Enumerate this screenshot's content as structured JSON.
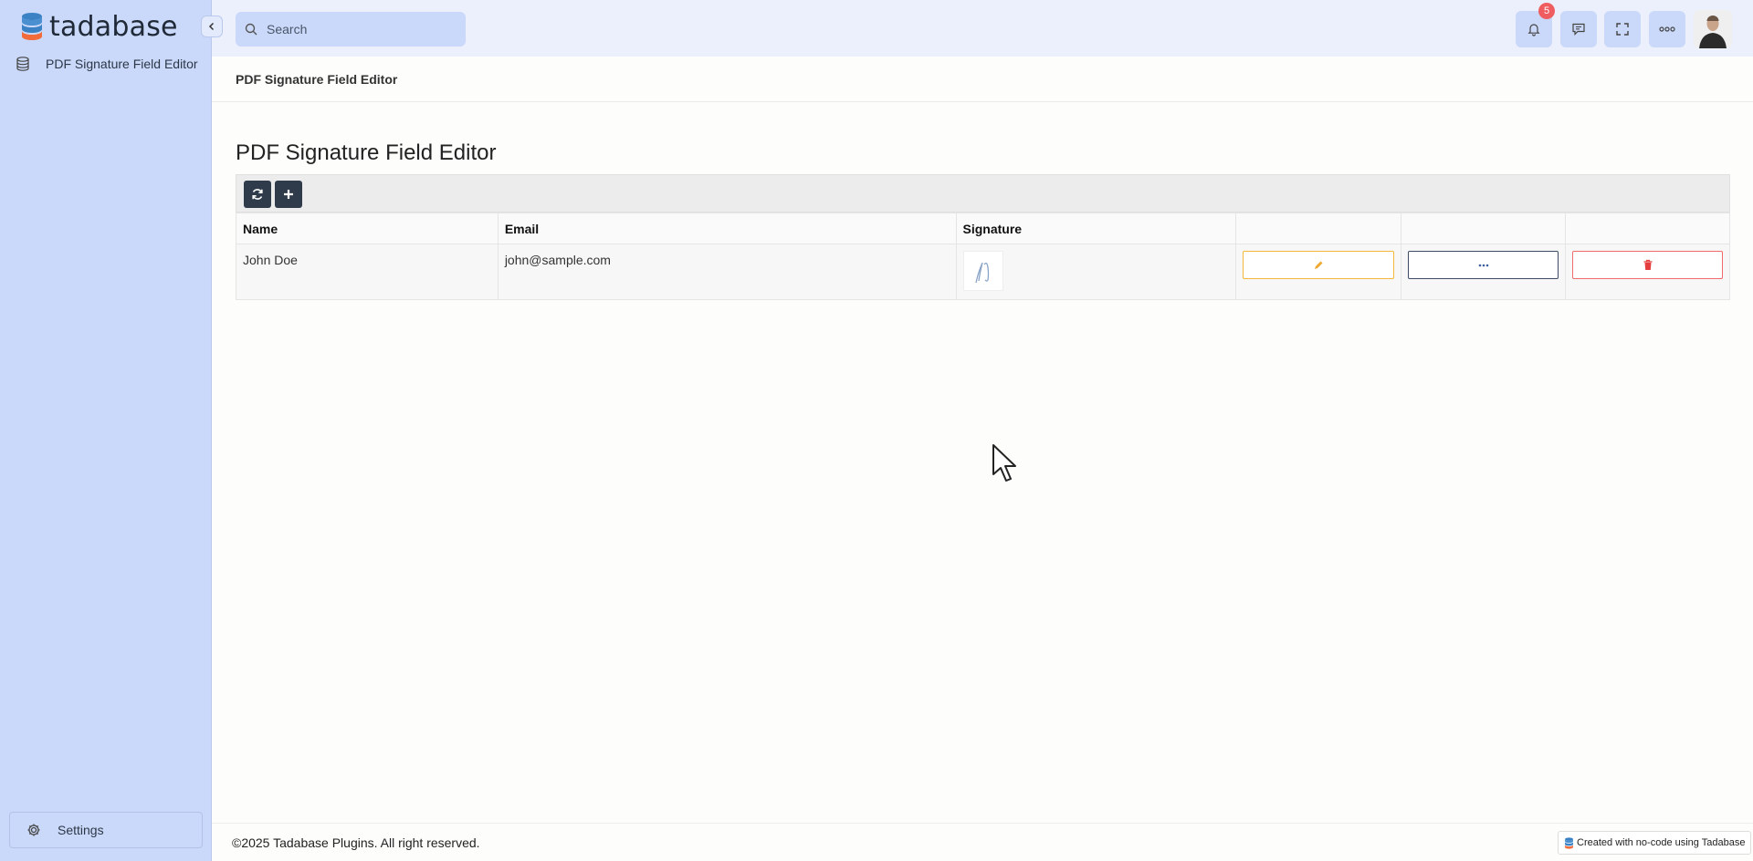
{
  "app": {
    "brand": "tadabase"
  },
  "sidebar": {
    "items": [
      {
        "label": "PDF Signature Field Editor",
        "icon": "database-icon"
      }
    ],
    "settings_label": "Settings"
  },
  "topbar": {
    "search_placeholder": "Search",
    "notifications_count": "5"
  },
  "breadcrumb": "PDF Signature Field Editor",
  "page": {
    "title": "PDF Signature Field Editor",
    "table": {
      "headers": [
        "Name",
        "Email",
        "Signature",
        "",
        "",
        ""
      ],
      "rows": [
        {
          "name": "John Doe",
          "email": "john@sample.com"
        }
      ]
    }
  },
  "footer": {
    "copyright": "©2025 Tadabase Plugins. All right reserved.",
    "made_with": "Created with no-code using Tadabase"
  },
  "colors": {
    "accent": "#cad9f9",
    "edit": "#f6b73c",
    "delete": "#ef6a6a",
    "dark": "#2f3a4a"
  }
}
